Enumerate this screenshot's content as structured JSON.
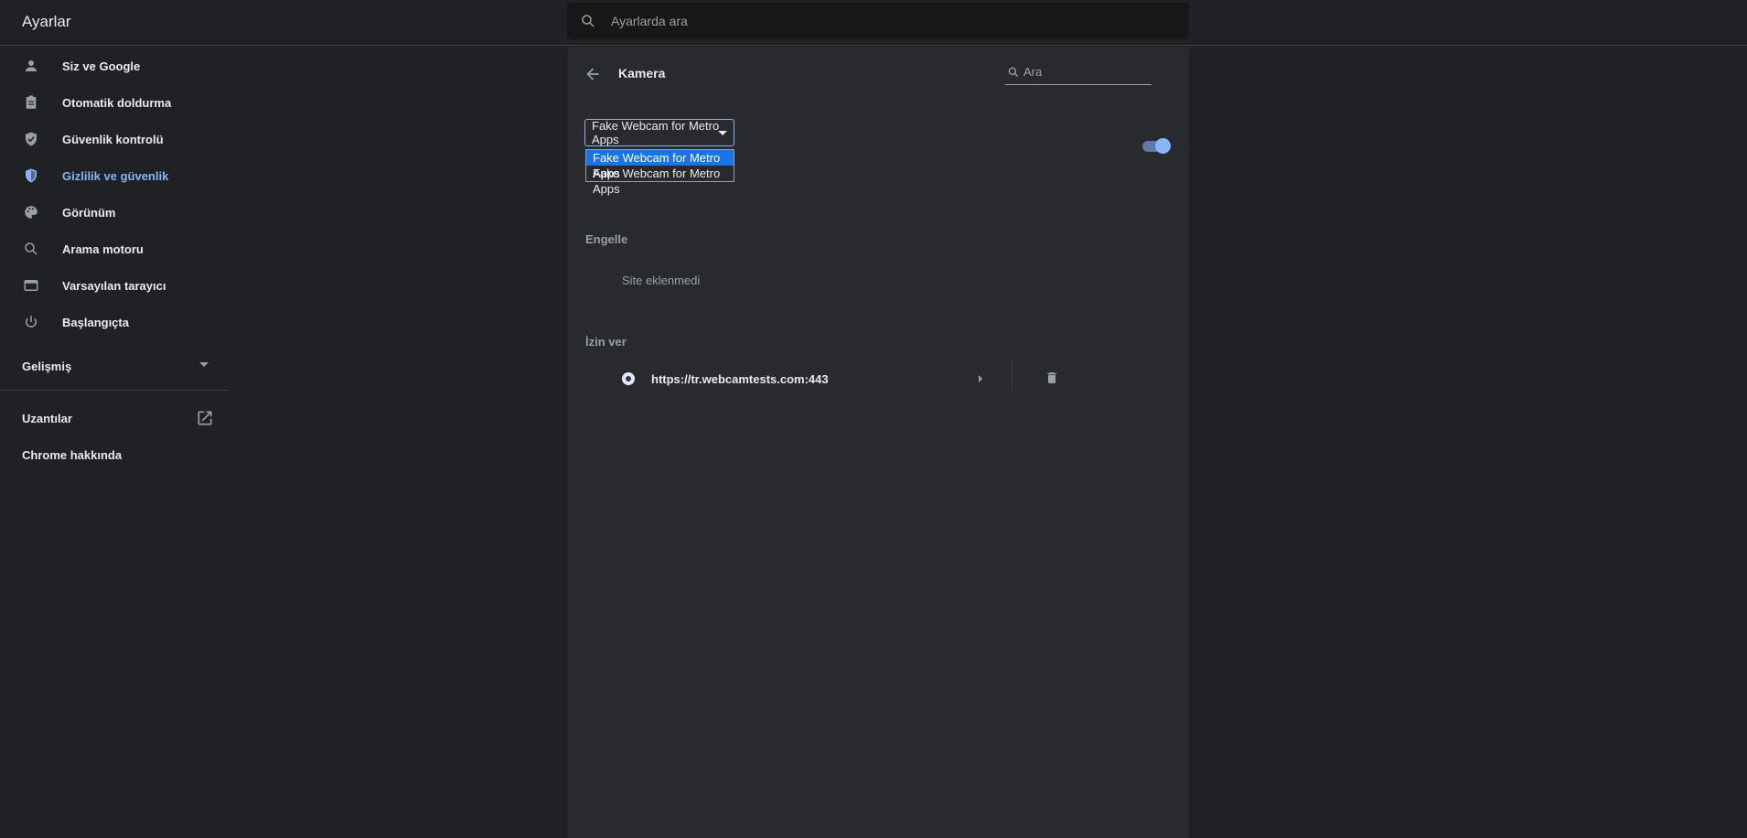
{
  "header": {
    "app_title": "Ayarlar",
    "search_placeholder": "Ayarlarda ara"
  },
  "sidebar": {
    "items": [
      {
        "label": "Siz ve Google",
        "icon": "person-icon",
        "active": false
      },
      {
        "label": "Otomatik doldurma",
        "icon": "clipboard-icon",
        "active": false
      },
      {
        "label": "Güvenlik kontrolü",
        "icon": "shield-check-icon",
        "active": false
      },
      {
        "label": "Gizlilik ve güvenlik",
        "icon": "shield-half-icon",
        "active": true
      },
      {
        "label": "Görünüm",
        "icon": "palette-icon",
        "active": false
      },
      {
        "label": "Arama motoru",
        "icon": "search-icon",
        "active": false
      },
      {
        "label": "Varsayılan tarayıcı",
        "icon": "browser-icon",
        "active": false
      },
      {
        "label": "Başlangıçta",
        "icon": "power-icon",
        "active": false
      }
    ],
    "advanced_label": "Gelişmiş",
    "extensions_label": "Uzantılar",
    "about_label": "Chrome hakkında"
  },
  "panel": {
    "title": "Kamera",
    "search_placeholder": "Ara",
    "camera_select": {
      "value": "Fake Webcam for Metro Apps",
      "options": [
        "Fake Webcam for Metro Apps",
        "Fake Webcam for Metro Apps"
      ],
      "highlighted_index": 0
    },
    "ask_toggle_on": true,
    "block_section": {
      "title": "Engelle",
      "empty_text": "Site eklenmedi"
    },
    "allow_section": {
      "title": "İzin ver",
      "sites": [
        {
          "url": "https://tr.webcamtests.com:443"
        }
      ]
    }
  },
  "colors": {
    "background": "#202124",
    "panel": "#292a2d",
    "accent": "#8ab4f8",
    "highlight": "#1a73e8"
  }
}
